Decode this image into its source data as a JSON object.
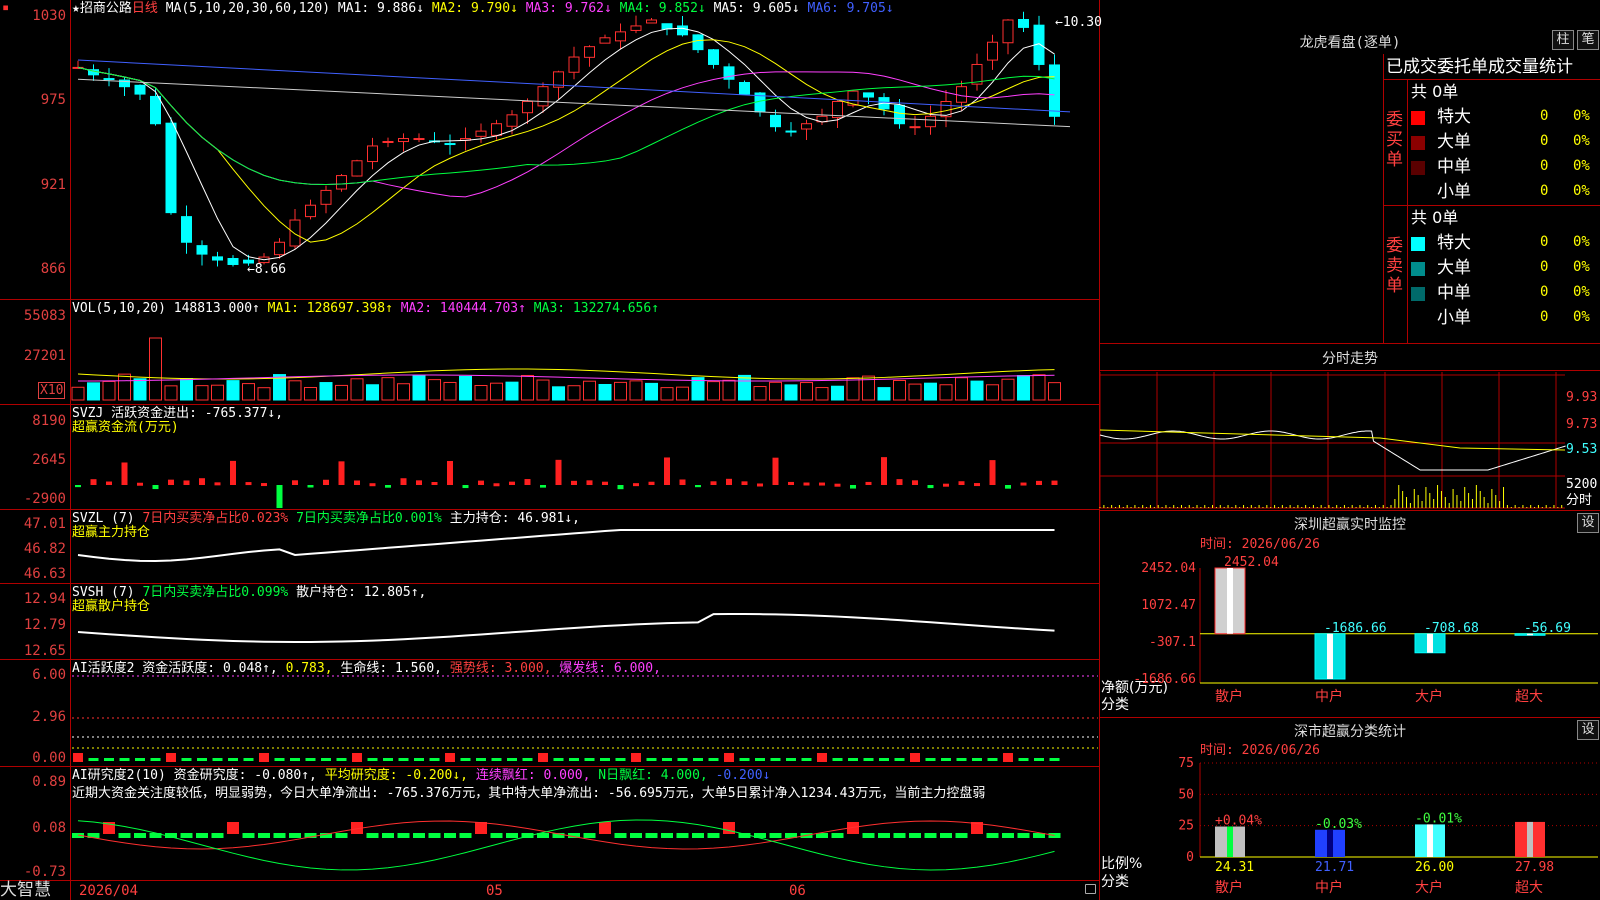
{
  "menu": {
    "icon": "menu-icon"
  },
  "stock": {
    "star": "★",
    "name": "招商公路",
    "period": "日线",
    "ma_header": "MA(5,10,20,30,60,120)",
    "ma1": "MA1: 9.886↓",
    "ma2": "MA2: 9.790↓",
    "ma3": "MA3: 9.762↓",
    "ma4": "MA4: 9.852↓",
    "ma5": "MA5: 9.605↓",
    "ma6": "MA6: 9.705↓",
    "high_mark": "10.30",
    "low_mark": "8.66"
  },
  "price_axis": [
    "1030",
    "975",
    "921",
    "866"
  ],
  "vol": {
    "header": "VOL(5,10,20)",
    "value": "148813.000↑",
    "ma1": "MA1: 128697.398↑",
    "ma2": "MA2: 140444.703↑",
    "ma3": "MA3: 132274.656↑",
    "axis": [
      "55083",
      "27201"
    ],
    "unit": "X10"
  },
  "svzj": {
    "header": "SVZJ  活跃资金进出: -765.377↓,",
    "sub": "超赢资金流(万元)",
    "axis": [
      "8190",
      "2645",
      "-2900"
    ]
  },
  "svzl": {
    "header": "SVZL (7)",
    "buy": "7日内买卖净占比0.023%",
    "buy2": "7日内买卖净占比0.001%",
    "hold": "主力持仓: 46.981↓,",
    "sub": "超赢主力持仓",
    "axis": [
      "47.01",
      "46.82",
      "46.63"
    ]
  },
  "svsh": {
    "header": "SVSH (7)",
    "buy": "7日内买卖净占比0.099%",
    "hold": "散户持仓: 12.805↑,",
    "sub": "超赢散户持仓",
    "axis": [
      "12.94",
      "12.79",
      "12.65"
    ]
  },
  "ai1": {
    "header": "AI活跃度2 资金活跃度: 0.048↑,",
    "v2": "0.783,",
    "life": "生命线: 1.560,",
    "strong": "强势线: 3.000,",
    "burst": "爆发线: 6.000,",
    "axis": [
      "6.00",
      "2.96",
      "0.00"
    ]
  },
  "ai2": {
    "header": "AI研究度2(10) 资金研究度: -0.080↑,",
    "avg": "平均研究度: -0.200↓,",
    "red": "连续飘红: 0.000,",
    "nday": "N日飘红: 4.000,",
    "neg": "-0.200↓",
    "note": "近期大资金关注度较低，明显弱势，今日大单净流出: -765.376万元，其中特大单净流出: -56.695万元，大单5日累计净入1234.43万元，当前主力控盘弱",
    "axis": [
      "0.89",
      "0.08",
      "-0.73"
    ]
  },
  "dates": {
    "d1": "2026/04",
    "d2": "05",
    "d3": "06"
  },
  "brand": "大智慧",
  "lhkp": {
    "title": "龙虎看盘(逐单)",
    "btn_bar": "柱",
    "btn_pen": "笔",
    "heading": "已成交委托单成交量统计",
    "buy": {
      "label": "委买单",
      "total": "共 0单",
      "rows": [
        {
          "name": "特大",
          "n": "0",
          "pct": "0%",
          "color": "#ff0000"
        },
        {
          "name": "大单",
          "n": "0",
          "pct": "0%",
          "color": "#8b0000"
        },
        {
          "name": "中单",
          "n": "0",
          "pct": "0%",
          "color": "#5a0000"
        },
        {
          "name": "小单",
          "n": "0",
          "pct": "0%",
          "color": ""
        }
      ]
    },
    "sell": {
      "label": "委卖单",
      "total": "共 0单",
      "rows": [
        {
          "name": "特大",
          "n": "0",
          "pct": "0%",
          "color": "#00ffff"
        },
        {
          "name": "大单",
          "n": "0",
          "pct": "0%",
          "color": "#008c8c"
        },
        {
          "name": "中单",
          "n": "0",
          "pct": "0%",
          "color": "#006a6a"
        },
        {
          "name": "小单",
          "n": "0",
          "pct": "0%",
          "color": ""
        }
      ]
    }
  },
  "fenshi": {
    "title": "分时走势",
    "axis": [
      "9.93",
      "9.73",
      "9.53"
    ],
    "vol": "5200",
    "vol_unit": "分时"
  },
  "monitor": {
    "title": "深圳超赢实时监控",
    "btn": "设",
    "time": "时间: 2026/06/26",
    "axis": [
      "2452.04",
      "1072.47",
      "-307.1",
      "-1686.66"
    ],
    "ylabel": "净额(万元)",
    "xlabel": "分类",
    "chart_data": {
      "type": "bar",
      "categories": [
        "散户",
        "中户",
        "大户",
        "超大"
      ],
      "values": [
        2452.04,
        -1686.66,
        -708.68,
        -56.69
      ],
      "ylim": [
        -1686.66,
        2452.04
      ]
    },
    "value_labels": [
      "2452.04",
      "-1686.66",
      "-708.68",
      "-56.69"
    ]
  },
  "classify": {
    "title": "深市超赢分类统计",
    "btn": "设",
    "time": "时间: 2026/06/26",
    "axis": [
      "75",
      "50",
      "25",
      "0"
    ],
    "ylabel": "比例%",
    "xlabel": "分类",
    "chart_data": {
      "type": "bar",
      "categories": [
        "散户",
        "中户",
        "大户",
        "超大"
      ],
      "values": [
        24.31,
        21.71,
        26.0,
        27.98
      ],
      "changes": [
        "+0.04%",
        "-0.03%",
        "-0.01%",
        ""
      ],
      "ylim": [
        0,
        75
      ]
    },
    "value_labels": [
      "24.31",
      "21.71",
      "26.00",
      "27.98"
    ]
  }
}
